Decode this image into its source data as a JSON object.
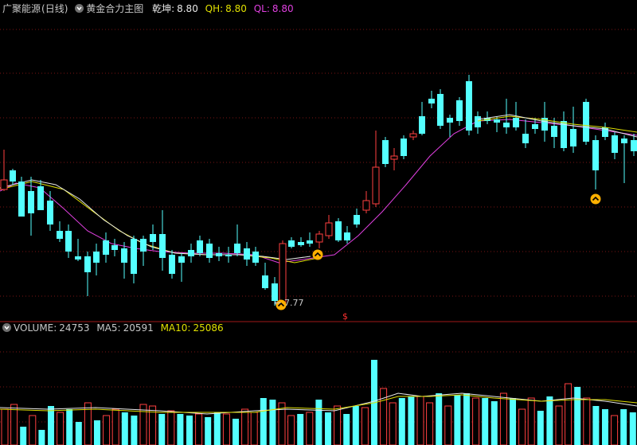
{
  "main": {
    "stock_name": "广聚能源",
    "period": "(日线)",
    "indicator": "黄金合力主图",
    "qk_label": "乾坤:",
    "qk_value": "8.80",
    "qh_label": "QH:",
    "qh_value": "8.80",
    "ql_label": "QL:",
    "ql_value": "8.80",
    "low_price_label": "7.77",
    "dollar_marker": "$"
  },
  "volume": {
    "label": "VOLUME:",
    "value": "24753",
    "ma5_label": "MA5:",
    "ma5_value": "20591",
    "ma10_label": "MA10:",
    "ma10_value": "25086"
  },
  "colors": {
    "up": "#ff4040",
    "down": "#54ffff",
    "grid": "#7a1414",
    "ma5": "#e8e8e8",
    "ma10": "#e0e000",
    "ql": "#e040e0",
    "signal": "#ffb000"
  }
}
